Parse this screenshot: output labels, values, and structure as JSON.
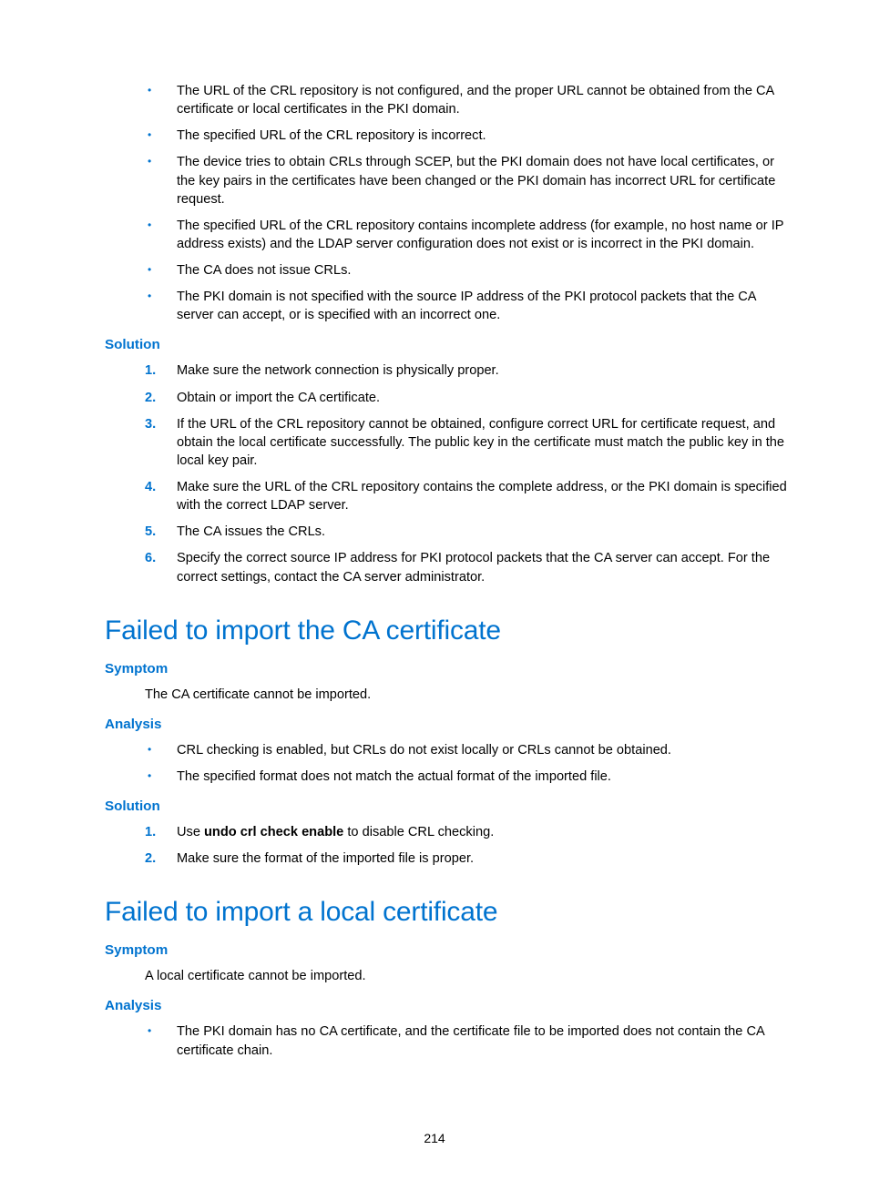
{
  "topBullets": [
    "The URL of the CRL repository is not configured, and the proper URL cannot be obtained from the CA certificate or local certificates in the PKI domain.",
    "The specified URL of the CRL repository is incorrect.",
    "The device tries to obtain CRLs through SCEP, but the PKI domain does not have local certificates, or the key pairs in the certificates have been changed or the PKI domain has incorrect URL for certificate request.",
    "The specified URL of the CRL repository contains incomplete address (for example, no host name or IP address exists) and the LDAP server configuration does not exist or is incorrect in the PKI domain.",
    "The CA does not issue CRLs.",
    "The PKI domain is not specified with the source IP address of the PKI protocol packets that the CA server can accept, or is specified with an incorrect one."
  ],
  "solutionHeading1": "Solution",
  "solutionList1": [
    "Make sure the network connection is physically proper.",
    "Obtain or import the CA certificate.",
    "If the URL of the CRL repository cannot be obtained, configure correct URL for certificate request, and obtain the local certificate successfully. The public key in the certificate must match the public key in the local key pair.",
    "Make sure the URL of the CRL repository contains the complete address, or the PKI domain is specified with the correct LDAP server.",
    "The CA issues the CRLs.",
    "Specify the correct source IP address for PKI protocol packets that the CA server can accept. For the correct settings, contact the CA server administrator."
  ],
  "section2": {
    "title": "Failed to import the CA certificate",
    "symptomHeading": "Symptom",
    "symptomText": "The CA certificate cannot be imported.",
    "analysisHeading": "Analysis",
    "analysisBullets": [
      "CRL checking is enabled, but CRLs do not exist locally or CRLs cannot be obtained.",
      "The specified format does not match the actual format of the imported file."
    ],
    "solutionHeading": "Solution",
    "solutionList_pre": "Use ",
    "solutionList_bold": "undo crl check enable",
    "solutionList_post": " to disable CRL checking.",
    "solutionList2": "Make sure the format of the imported file is proper."
  },
  "section3": {
    "title": "Failed to import a local certificate",
    "symptomHeading": "Symptom",
    "symptomText": "A local certificate cannot be imported.",
    "analysisHeading": "Analysis",
    "analysisBullets": [
      "The PKI domain has no CA certificate, and the certificate file to be imported does not contain the CA certificate chain."
    ]
  },
  "pageNumber": "214"
}
